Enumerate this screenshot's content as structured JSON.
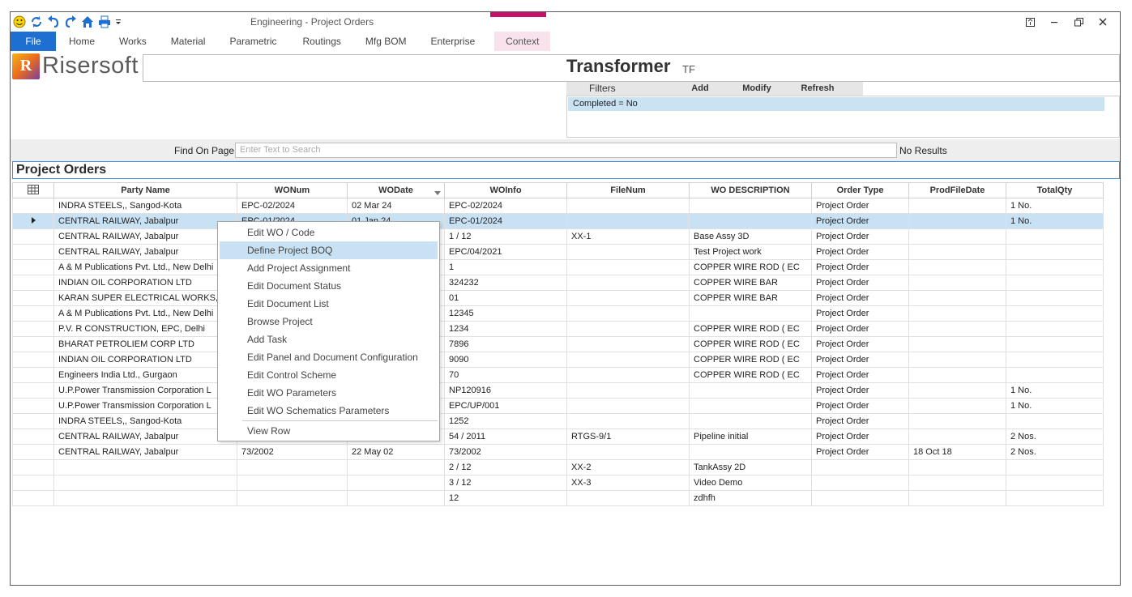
{
  "window": {
    "title": "Engineering - Project Orders",
    "controls": [
      "?",
      "–",
      "🗗",
      "✕"
    ]
  },
  "qat": [
    {
      "icon": "smiley-icon"
    },
    {
      "icon": "refresh-icon"
    },
    {
      "icon": "undo-icon"
    },
    {
      "icon": "redo-icon"
    },
    {
      "icon": "home-icon"
    },
    {
      "icon": "print-icon"
    },
    {
      "icon": "dropdown-icon"
    }
  ],
  "tabs": [
    "File",
    "Home",
    "Works",
    "Material",
    "Parametric",
    "Routings",
    "Mfg BOM",
    "Enterprise",
    "Context"
  ],
  "brand": {
    "logo_letter": "R",
    "name": "Risersoft"
  },
  "app": {
    "title": "Transformer",
    "subtitle": "TF"
  },
  "filters": {
    "label": "Filters",
    "buttons": [
      "Add",
      "Modify",
      "Refresh"
    ],
    "active": "Completed = No"
  },
  "find": {
    "label": "Find On Page",
    "placeholder": "Enter Text to Search",
    "status": "No Results"
  },
  "section": {
    "title": "Project Orders"
  },
  "columns": [
    "Party Name",
    "WONum",
    "WODate",
    "WOInfo",
    "FileNum",
    "WO DESCRIPTION",
    "Order Type",
    "ProdFileDate",
    "TotalQty"
  ],
  "rows": [
    [
      "INDRA STEELS,, Sangod-Kota",
      "EPC-02/2024",
      "02 Mar 24",
      "EPC-02/2024",
      "",
      "",
      "Project Order",
      "",
      "1 No."
    ],
    [
      "CENTRAL RAILWAY, Jabalpur",
      "EPC-01/2024",
      "01 Jan 24",
      "EPC-01/2024",
      "",
      "",
      "Project Order",
      "",
      "1 No."
    ],
    [
      "CENTRAL RAILWAY, Jabalpur",
      "",
      "",
      "1 / 12",
      "XX-1",
      "Base Assy 3D",
      "Project Order",
      "",
      ""
    ],
    [
      "CENTRAL RAILWAY, Jabalpur",
      "",
      "",
      "EPC/04/2021",
      "",
      "Test Project work",
      "Project Order",
      "",
      ""
    ],
    [
      "A & M Publications Pvt. Ltd., New Delhi",
      "",
      "",
      "1",
      "",
      "COPPER WIRE ROD ( EC",
      "Project Order",
      "",
      ""
    ],
    [
      "INDIAN OIL CORPORATION LTD",
      "",
      "",
      "324232",
      "",
      "COPPER WIRE BAR",
      "Project Order",
      "",
      ""
    ],
    [
      "KARAN SUPER ELECTRICAL WORKS,",
      "",
      "",
      "01",
      "",
      "COPPER WIRE BAR",
      "Project Order",
      "",
      ""
    ],
    [
      "A & M Publications Pvt. Ltd., New Delhi",
      "",
      "",
      "12345",
      "",
      "",
      "Project Order",
      "",
      ""
    ],
    [
      "P.V. R CONSTRUCTION, EPC, Delhi",
      "",
      "",
      "1234",
      "",
      "COPPER WIRE ROD ( EC",
      "Project Order",
      "",
      ""
    ],
    [
      "BHARAT PETROLIEM CORP LTD",
      "",
      "",
      "7896",
      "",
      "COPPER WIRE ROD ( EC",
      "Project Order",
      "",
      ""
    ],
    [
      "INDIAN OIL CORPORATION LTD",
      "",
      "",
      "9090",
      "",
      "COPPER WIRE ROD ( EC",
      "Project Order",
      "",
      ""
    ],
    [
      "Engineers India Ltd., Gurgaon",
      "",
      "",
      "70",
      "",
      "COPPER WIRE ROD ( EC",
      "Project Order",
      "",
      ""
    ],
    [
      "U.P.Power Transmission Corporation L",
      "",
      "",
      "NP120916",
      "",
      "",
      "Project Order",
      "",
      "1 No."
    ],
    [
      "U.P.Power Transmission Corporation L",
      "",
      "",
      "EPC/UP/001",
      "",
      "",
      "Project Order",
      "",
      "1 No."
    ],
    [
      "INDRA STEELS,, Sangod-Kota",
      "",
      "",
      "1252",
      "",
      "",
      "Project Order",
      "",
      ""
    ],
    [
      "CENTRAL RAILWAY, Jabalpur",
      "",
      "",
      "54 / 2011",
      "RTGS-9/1",
      "Pipeline initial",
      "Project Order",
      "",
      "2 Nos."
    ],
    [
      "CENTRAL RAILWAY, Jabalpur",
      "73/2002",
      "22 May 02",
      "73/2002",
      "",
      "",
      "Project Order",
      "18 Oct 18",
      "2 Nos."
    ],
    [
      "",
      "",
      "",
      "2 / 12",
      "XX-2",
      "TankAssy 2D",
      "",
      "",
      ""
    ],
    [
      "",
      "",
      "",
      "3 / 12",
      "XX-3",
      "Video Demo",
      "",
      "",
      ""
    ],
    [
      "",
      "",
      "",
      "12",
      "",
      "zdhfh",
      "",
      "",
      ""
    ]
  ],
  "selected_row_index": 1,
  "context_menu": {
    "items": [
      "Edit WO / Code",
      "Define Project BOQ",
      "Add Project Assignment",
      "Edit Document Status",
      "Edit Document List",
      "Browse  Project",
      "Add Task",
      "Edit Panel and Document Configuration",
      "Edit Control Scheme",
      "Edit WO Parameters",
      "Edit WO Schematics Parameters"
    ],
    "hover_index": 1,
    "after_separator": "View Row"
  },
  "colors": {
    "accent": "#1e6fd2",
    "context_tab": "#c8106a",
    "selection": "#c8e2f4",
    "section_border": "#3a8fd6"
  }
}
